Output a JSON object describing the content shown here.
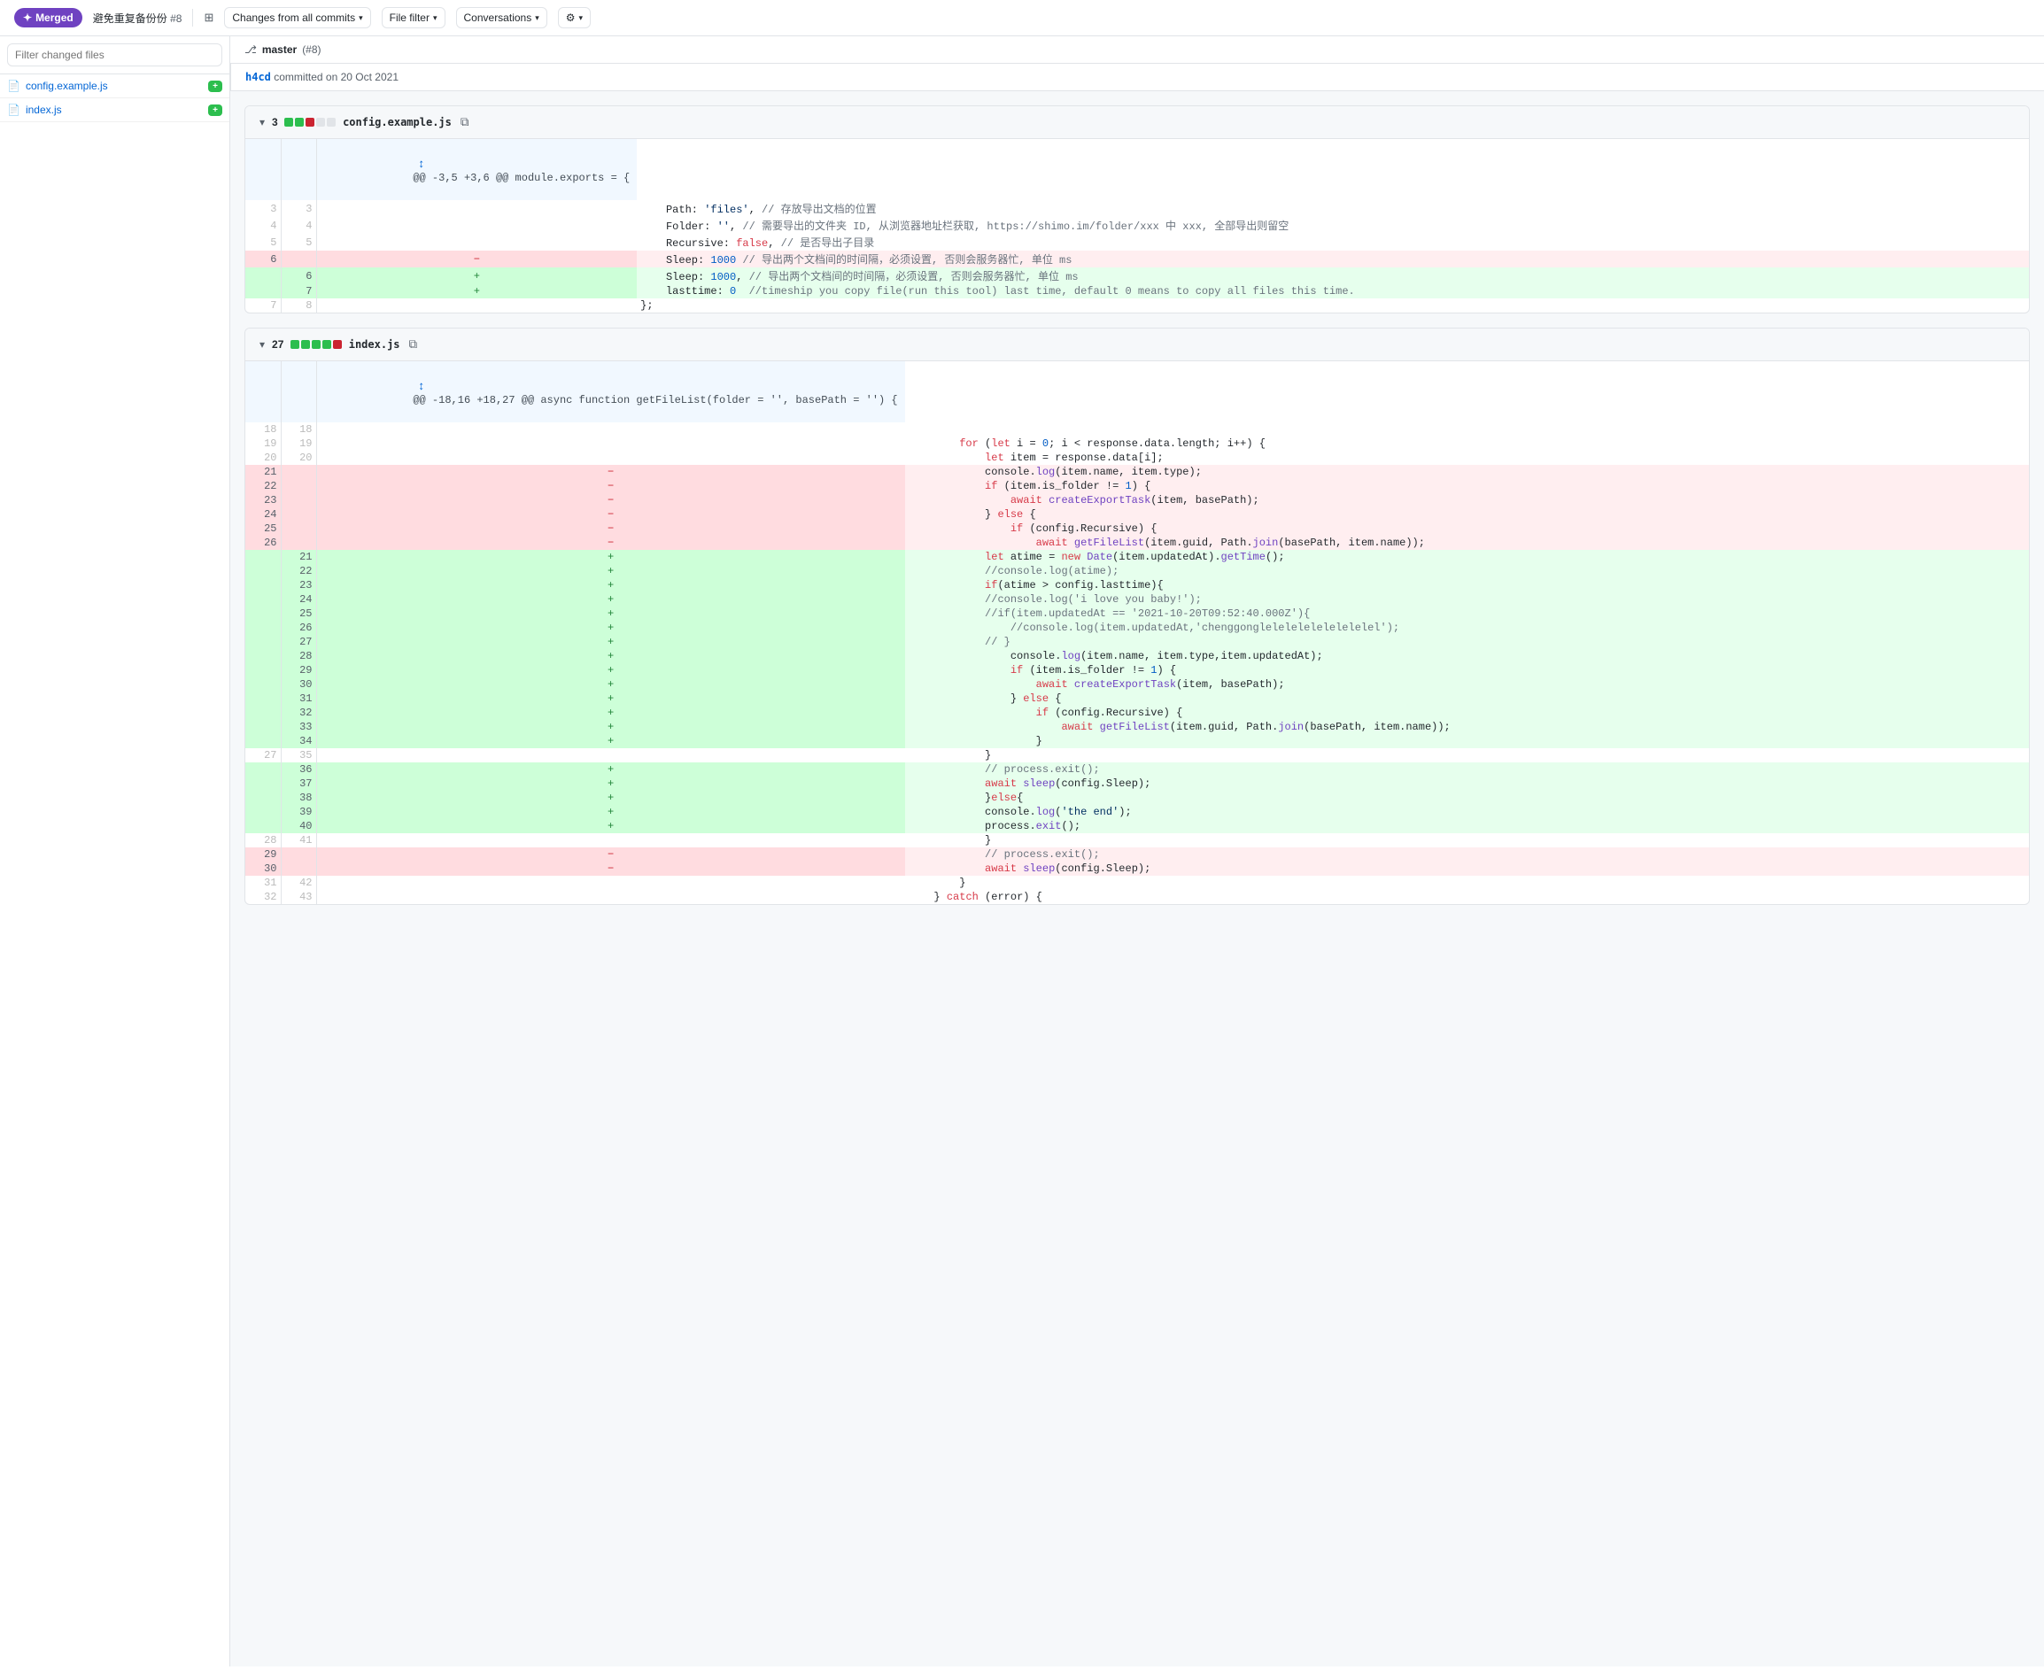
{
  "header": {
    "merged_label": "Merged",
    "pr_title": "避免重复备份份",
    "pr_number": "#8",
    "commits_dropdown": "Changes from all commits",
    "file_filter": "File filter",
    "conversations": "Conversations",
    "settings_icon": "⚙"
  },
  "sidebar": {
    "search_placeholder": "Filter changed files",
    "files": [
      {
        "name": "config.example.js",
        "badge": "+"
      },
      {
        "name": "index.js",
        "badge": "+"
      }
    ]
  },
  "branch_header": {
    "icon": "⎇",
    "branch": "master",
    "pr": "(#8)"
  },
  "commit": {
    "hash": "h4cd",
    "action": "committed on",
    "date": "20 Oct 2021"
  },
  "diff_files": [
    {
      "filename": "config.example.js",
      "additions": 3,
      "stat_blocks": [
        "add",
        "add",
        "del",
        "neutral",
        "neutral"
      ],
      "hunk_header": "@@ -3,5 +3,6 @@ module.exports = {",
      "expand_icon": "↕",
      "lines": [
        {
          "type": "context",
          "old_num": "3",
          "new_num": "3",
          "sign": "",
          "code": "    Path: 'files', // 存放导出文档的位置"
        },
        {
          "type": "context",
          "old_num": "4",
          "new_num": "4",
          "sign": "",
          "code": "    Folder: '', // 需要导出的文件夹 ID, 从浏览器地址栏获取, https://shimo.im/folder/xxx 中 xxx, 全部导出则留空"
        },
        {
          "type": "context",
          "old_num": "5",
          "new_num": "5",
          "sign": "",
          "code": "    Recursive: false, // 是否导出子目录"
        },
        {
          "type": "del",
          "old_num": "6",
          "new_num": "",
          "sign": "-",
          "code": "    Sleep: 1000 // 导出两个文档间的时间隔，必须设置, 否则会服务器忙, 单位 ms"
        },
        {
          "type": "add",
          "old_num": "",
          "new_num": "6",
          "sign": "+",
          "code": "    Sleep: 1000, // 导出两个文档间的时间隔，必须设置, 否则会服务器忙, 单位 ms"
        },
        {
          "type": "add",
          "old_num": "",
          "new_num": "7",
          "sign": "+",
          "code": "    lasttime: 0  //timeship you copy file(run this tool) last time, default 0 means to copy all files this time."
        },
        {
          "type": "context",
          "old_num": "7",
          "new_num": "8",
          "sign": "",
          "code": "};"
        }
      ]
    },
    {
      "filename": "index.js",
      "additions": 27,
      "stat_blocks": [
        "add",
        "add",
        "add",
        "add",
        "del"
      ],
      "hunk_header": "@@ -18,16 +18,27 @@ async function getFileList(folder = '', basePath = '') {",
      "expand_icon": "↕",
      "lines": [
        {
          "type": "context",
          "old_num": "18",
          "new_num": "18",
          "sign": "",
          "code": ""
        },
        {
          "type": "context",
          "old_num": "19",
          "new_num": "19",
          "sign": "",
          "code": "        for (let i = 0; i < response.data.length; i++) {"
        },
        {
          "type": "context",
          "old_num": "20",
          "new_num": "20",
          "sign": "",
          "code": "            let item = response.data[i];"
        },
        {
          "type": "del",
          "old_num": "21",
          "new_num": "",
          "sign": "-",
          "code": "            console.log(item.name, item.type);"
        },
        {
          "type": "del",
          "old_num": "22",
          "new_num": "",
          "sign": "-",
          "code": "            if (item.is_folder != 1) {"
        },
        {
          "type": "del",
          "old_num": "23",
          "new_num": "",
          "sign": "-",
          "code": "                await createExportTask(item, basePath);"
        },
        {
          "type": "del",
          "old_num": "24",
          "new_num": "",
          "sign": "-",
          "code": "            } else {"
        },
        {
          "type": "del",
          "old_num": "25",
          "new_num": "",
          "sign": "-",
          "code": "                if (config.Recursive) {"
        },
        {
          "type": "del",
          "old_num": "26",
          "new_num": "",
          "sign": "-",
          "code": "                    await getFileList(item.guid, Path.join(basePath, item.name));"
        },
        {
          "type": "add",
          "old_num": "",
          "new_num": "21",
          "sign": "+",
          "code": "            let atime = new Date(item.updatedAt).getTime();"
        },
        {
          "type": "add",
          "old_num": "",
          "new_num": "22",
          "sign": "+",
          "code": "            //console.log(atime);"
        },
        {
          "type": "add",
          "old_num": "",
          "new_num": "23",
          "sign": "+",
          "code": "            if(atime > config.lasttime){"
        },
        {
          "type": "add",
          "old_num": "",
          "new_num": "24",
          "sign": "+",
          "code": "            //console.log('i love you baby!');"
        },
        {
          "type": "add",
          "old_num": "",
          "new_num": "25",
          "sign": "+",
          "code": "            //if(item.updatedAt == '2021-10-20T09:52:40.000Z'){"
        },
        {
          "type": "add",
          "old_num": "",
          "new_num": "26",
          "sign": "+",
          "code": "                //console.log(item.updatedAt,'chenggonglelelelelelelelelel');"
        },
        {
          "type": "add",
          "old_num": "",
          "new_num": "27",
          "sign": "+",
          "code": "            // }"
        },
        {
          "type": "add",
          "old_num": "",
          "new_num": "28",
          "sign": "+",
          "code": "                console.log(item.name, item.type,item.updatedAt);"
        },
        {
          "type": "add",
          "old_num": "",
          "new_num": "29",
          "sign": "+",
          "code": "                if (item.is_folder != 1) {"
        },
        {
          "type": "add",
          "old_num": "",
          "new_num": "30",
          "sign": "+",
          "code": "                    await createExportTask(item, basePath);"
        },
        {
          "type": "add",
          "old_num": "",
          "new_num": "31",
          "sign": "+",
          "code": "                } else {"
        },
        {
          "type": "add",
          "old_num": "",
          "new_num": "32",
          "sign": "+",
          "code": "                    if (config.Recursive) {"
        },
        {
          "type": "add",
          "old_num": "",
          "new_num": "33",
          "sign": "+",
          "code": "                        await getFileList(item.guid, Path.join(basePath, item.name));"
        },
        {
          "type": "add",
          "old_num": "",
          "new_num": "34",
          "sign": "+",
          "code": "                    }"
        },
        {
          "type": "context",
          "old_num": "27",
          "new_num": "35",
          "sign": "",
          "code": "            }"
        },
        {
          "type": "add",
          "old_num": "",
          "new_num": "36",
          "sign": "+",
          "code": "            // process.exit();"
        },
        {
          "type": "add",
          "old_num": "",
          "new_num": "37",
          "sign": "+",
          "code": "            await sleep(config.Sleep);"
        },
        {
          "type": "add",
          "old_num": "",
          "new_num": "38",
          "sign": "+",
          "code": "            }else{"
        },
        {
          "type": "add",
          "old_num": "",
          "new_num": "39",
          "sign": "+",
          "code": "            console.log('the end');"
        },
        {
          "type": "add",
          "old_num": "",
          "new_num": "40",
          "sign": "+",
          "code": "            process.exit();"
        },
        {
          "type": "context",
          "old_num": "28",
          "new_num": "41",
          "sign": "",
          "code": "            }"
        },
        {
          "type": "del",
          "old_num": "29",
          "new_num": "",
          "sign": "-",
          "code": "            // process.exit();"
        },
        {
          "type": "del",
          "old_num": "30",
          "new_num": "",
          "sign": "-",
          "code": "            await sleep(config.Sleep);"
        },
        {
          "type": "context",
          "old_num": "31",
          "new_num": "42",
          "sign": "",
          "code": "        }"
        },
        {
          "type": "context",
          "old_num": "32",
          "new_num": "43",
          "sign": "",
          "code": "    } catch (error) {"
        }
      ]
    }
  ],
  "colors": {
    "add_bg": "#e6ffed",
    "add_num_bg": "#cdffd8",
    "del_bg": "#ffeef0",
    "del_num_bg": "#ffdce0",
    "hunk_bg": "#f1f8ff",
    "merged_badge": "#6f42c1"
  }
}
